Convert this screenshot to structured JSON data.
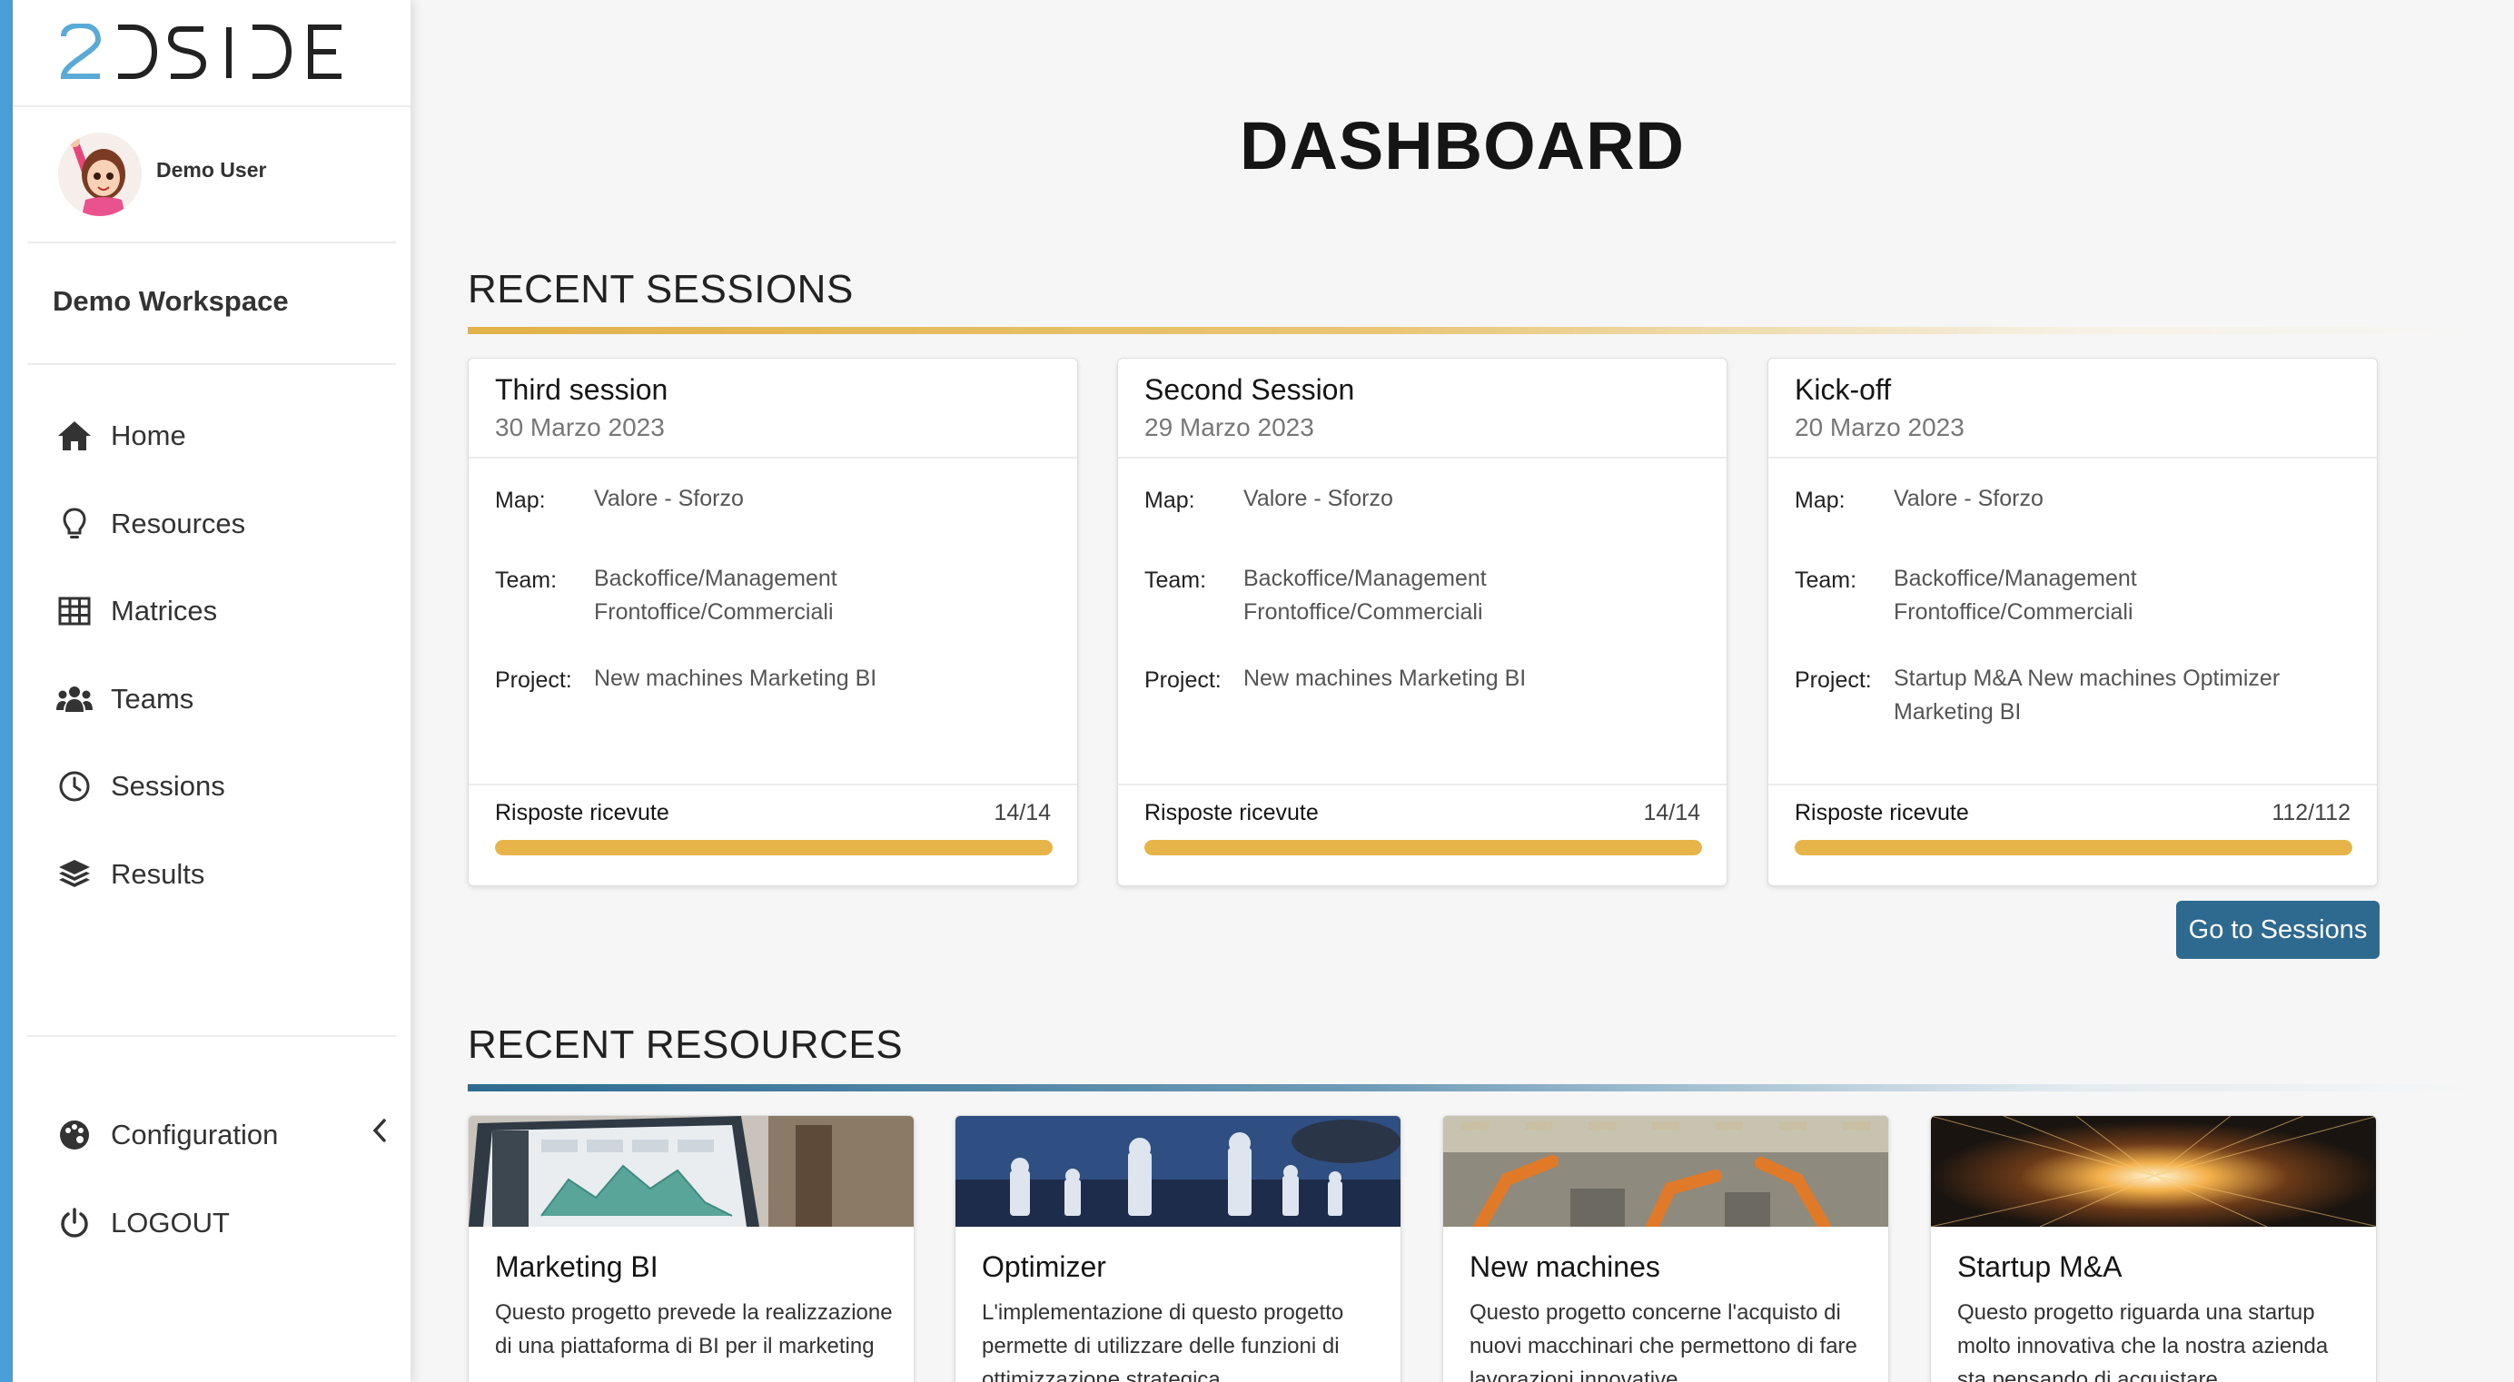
{
  "brand": {
    "logo_text": "2DSIDE",
    "colors": {
      "blue": "#4a9fd8",
      "dark": "#222222"
    }
  },
  "user": {
    "name": "Demo User",
    "avatar_icon": "avatar-cartoon-girl"
  },
  "workspace": {
    "name": "Demo Workspace"
  },
  "nav": {
    "items": [
      {
        "label": "Home",
        "icon": "home-icon"
      },
      {
        "label": "Resources",
        "icon": "lightbulb-icon"
      },
      {
        "label": "Matrices",
        "icon": "grid-icon"
      },
      {
        "label": "Teams",
        "icon": "users-icon"
      },
      {
        "label": "Sessions",
        "icon": "clock-icon"
      },
      {
        "label": "Results",
        "icon": "layers-icon"
      }
    ],
    "bottom": [
      {
        "label": "Configuration",
        "icon": "palette-icon"
      },
      {
        "label": "LOGOUT",
        "icon": "power-icon"
      }
    ]
  },
  "page": {
    "title": "DASHBOARD"
  },
  "sessions": {
    "title": "RECENT SESSIONS",
    "map_label": "Map:",
    "team_label": "Team:",
    "project_label": "Project:",
    "responses_label": "Risposte ricevute",
    "button_label": "Go to Sessions",
    "items": [
      {
        "name": "Third session",
        "date": "30 Marzo 2023",
        "map": "Valore - Sforzo",
        "team_line1": "Backoffice/Management",
        "team_line2": "Frontoffice/Commerciali",
        "project": "New machines Marketing BI",
        "responses": "14/14",
        "progress": 1.0
      },
      {
        "name": "Second Session",
        "date": "29 Marzo 2023",
        "map": "Valore - Sforzo",
        "team_line1": "Backoffice/Management",
        "team_line2": "Frontoffice/Commerciali",
        "project": "New machines Marketing BI",
        "responses": "14/14",
        "progress": 1.0
      },
      {
        "name": "Kick-off",
        "date": "20 Marzo 2023",
        "map": "Valore - Sforzo",
        "team_line1": "Backoffice/Management",
        "team_line2": "Frontoffice/Commerciali",
        "project": "Startup M&A New machines Optimizer Marketing BI",
        "responses": "112/112",
        "progress": 1.0
      }
    ]
  },
  "resources": {
    "title": "RECENT RESOURCES",
    "items": [
      {
        "title": "Marketing BI",
        "desc": "Questo progetto prevede la realizzazione di una piattaforma di BI per il marketing"
      },
      {
        "title": "Optimizer",
        "desc": "L'implementazione di questo progetto permette di utilizzare delle funzioni di ottimizzazione strategica"
      },
      {
        "title": "New machines",
        "desc": "Questo progetto concerne l'acquisto di nuovi macchinari che permettono di fare lavorazioni innovative"
      },
      {
        "title": "Startup M&A",
        "desc": "Questo progetto riguarda una startup molto innovativa che la nostra azienda sta pensando di acquistare"
      }
    ]
  }
}
